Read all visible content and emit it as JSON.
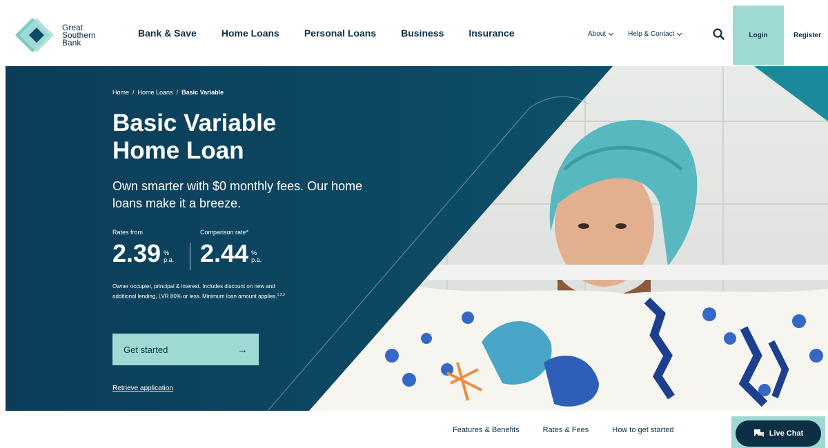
{
  "brand": {
    "logo_lines": [
      "Great",
      "Southern",
      "Bank"
    ]
  },
  "main_nav": {
    "items": [
      "Bank & Save",
      "Home Loans",
      "Personal Loans",
      "Business",
      "Insurance"
    ]
  },
  "util_nav": {
    "about": "About",
    "help": "Help & Contact",
    "search_icon": "search-icon",
    "login": "Login",
    "register": "Register"
  },
  "hero": {
    "breadcrumb": [
      "Home",
      "Home Loans",
      "Basic Variable"
    ],
    "title_line1": "Basic Variable",
    "title_line2": "Home Loan",
    "subtitle": "Own smarter with $0 monthly fees. Our home loans make it a breeze.",
    "rates": [
      {
        "label": "Rates from",
        "value": "2.39",
        "unit_top": "%",
        "unit_bottom": "p.a."
      },
      {
        "label": "Comparison rate*",
        "value": "2.44",
        "unit_top": "%",
        "unit_bottom": "p.a."
      }
    ],
    "disclaimer": "Owner occupier, principal & interest. Includes discount on new and additional lending, LVR 80% or less. Minimum loan amount applies.",
    "disclaimer_sup": "1,2,3",
    "cta_label": "Get started",
    "cta_icon": "arrow-right-icon",
    "retrieve_label": "Retrieve application"
  },
  "sub_nav": {
    "items": [
      "Features & Benefits",
      "Rates & Fees",
      "How to get started"
    ]
  },
  "live_chat": {
    "label": "Live Chat",
    "icon": "chat-icon"
  },
  "colors": {
    "navy": "#0b2f44",
    "hero_teal": "#0d4a65",
    "mint": "#9fd9d3"
  }
}
